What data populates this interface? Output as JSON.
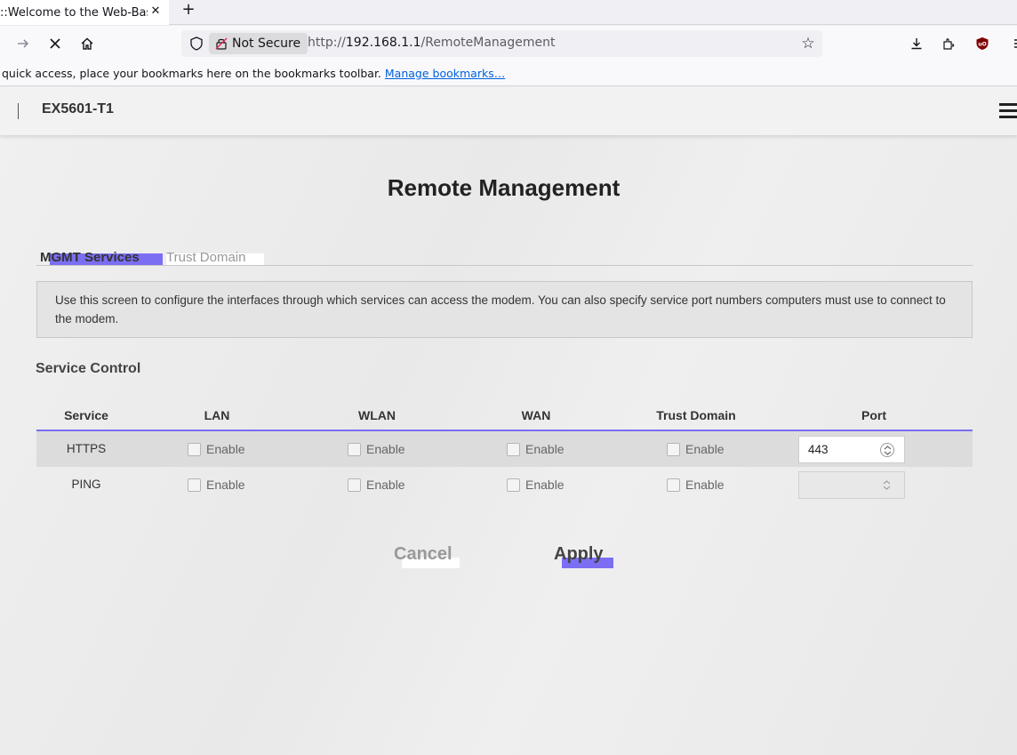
{
  "browser": {
    "tab_title": "::Welcome to the Web-Base",
    "tab_close": "✕",
    "new_tab": "+",
    "not_secure": "Not Secure",
    "url_prefix": "http://",
    "url_host": "192.168.1.1",
    "url_path": "/RemoteManagement",
    "bookmark_text": " quick access, place your bookmarks here on the bookmarks toolbar. ",
    "manage_bookmarks": "Manage bookmarks…"
  },
  "header": {
    "model": "EX5601-T1"
  },
  "page": {
    "title": "Remote Management",
    "tabs": [
      {
        "label": "MGMT Services",
        "active": true
      },
      {
        "label": "Trust Domain",
        "active": false
      }
    ],
    "info": "Use this screen to configure the interfaces through which services can access the modem. You can also specify service port numbers computers must use to connect to the modem.",
    "section_title": "Service Control"
  },
  "table": {
    "headers": [
      "Service",
      "LAN",
      "WLAN",
      "WAN",
      "Trust Domain",
      "Port"
    ],
    "enable_label": "Enable",
    "rows": [
      {
        "service": "HTTPS",
        "lan": false,
        "wlan": false,
        "wan": false,
        "trust": false,
        "port": "443",
        "port_disabled": false
      },
      {
        "service": "PING",
        "lan": false,
        "wlan": false,
        "wan": false,
        "trust": false,
        "port": "",
        "port_disabled": true
      }
    ]
  },
  "buttons": {
    "cancel": "Cancel",
    "apply": "Apply"
  },
  "colors": {
    "accent": "#7b6ef2"
  }
}
